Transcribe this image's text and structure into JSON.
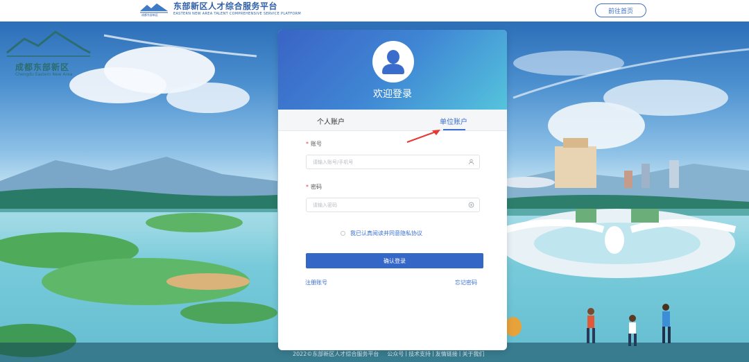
{
  "header": {
    "title": "东部新区人才综合服务平台",
    "subtitle": "EASTERN NEW AREA TALENT COMPREHENSIVE SERVICE PLATFORM",
    "home_button": "前往首页",
    "logo_icon": "mountain-logo-icon",
    "logo_text": "成都东部新区"
  },
  "city_logo": {
    "name": "成都东部新区",
    "name_en": "Chengdu Eastern New Area"
  },
  "login": {
    "title": "欢迎登录",
    "avatar_icon": "user-avatar-icon",
    "tabs": [
      {
        "label": "个人账户",
        "active": false
      },
      {
        "label": "单位账户",
        "active": true
      }
    ],
    "account_label": "账号",
    "account_placeholder": "请输入账号/手机号",
    "account_icon": "user-icon",
    "password_label": "密码",
    "password_placeholder": "请输入密码",
    "password_icon": "eye-icon",
    "agreement": "我已认真阅读并同意隐私协议",
    "submit": "确认登录",
    "register": "注册账号",
    "forgot": "忘记密码"
  },
  "footer": {
    "copyright": "2022©东部新区人才综合服务平台",
    "links": [
      "公众号",
      "技术支持",
      "友情链接",
      "关于我们"
    ]
  },
  "colors": {
    "accent": "#3567c6",
    "link": "#3b6fd0",
    "header_gradient_start": "#3a64c6",
    "header_gradient_end": "#55c4dc",
    "annotation_arrow": "#e53935"
  }
}
